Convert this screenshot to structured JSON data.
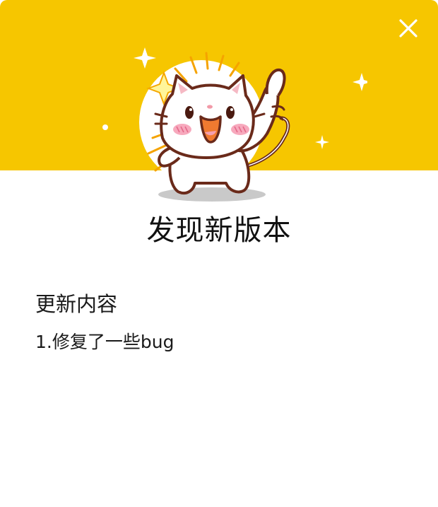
{
  "dialog": {
    "title": "发现新版本",
    "close_icon": "close-icon",
    "banner_color": "#f6c600",
    "illustration": "cat-thumbs-up-illustration"
  },
  "update": {
    "heading": "更新内容",
    "items": [
      "1.修复了一些bug"
    ]
  }
}
